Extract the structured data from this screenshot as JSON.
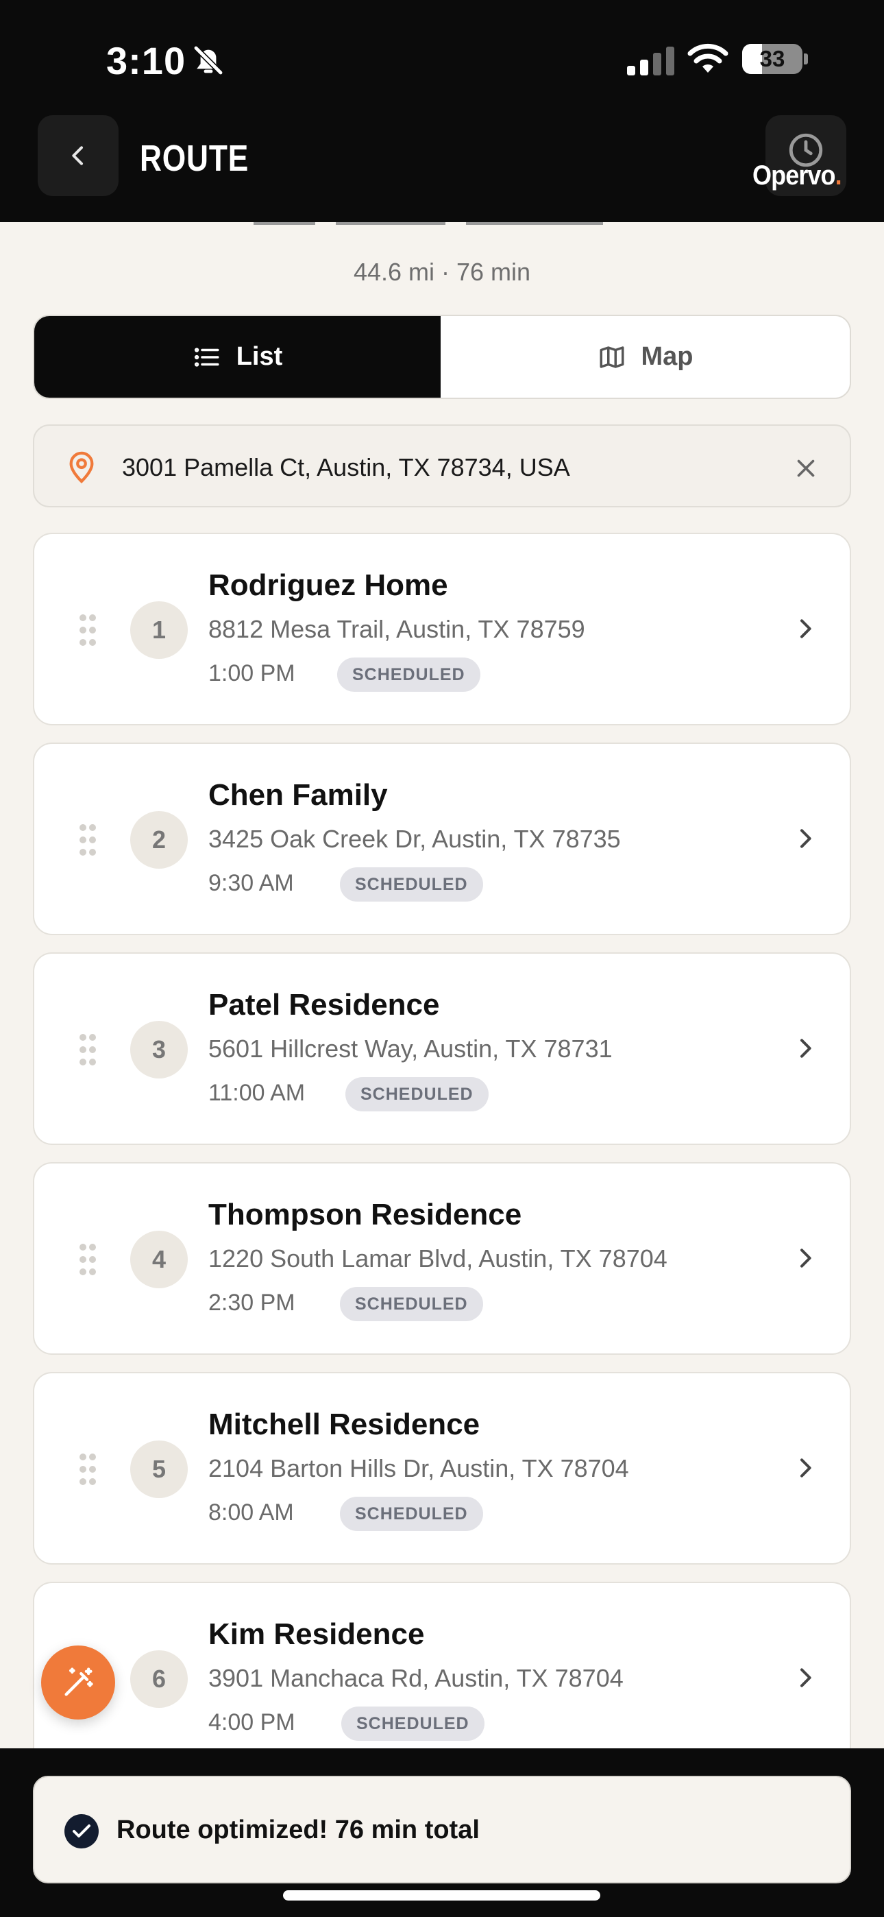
{
  "status_bar": {
    "time": "3:10",
    "battery": "33",
    "battery_level": 0.33
  },
  "header": {
    "title": "ROUTE",
    "brand": "Opervo",
    "brand_dot": "."
  },
  "summary": "44.6 mi · 76 min",
  "view_toggle": {
    "list_label": "List",
    "map_label": "Map",
    "selected": "List"
  },
  "start_location": {
    "value": "3001 Pamella Ct, Austin, TX 78734, USA"
  },
  "stops": [
    {
      "number": "1",
      "name": "Rodriguez Home",
      "address": "8812 Mesa Trail, Austin, TX 78759",
      "time": "1:00 PM",
      "status": "SCHEDULED"
    },
    {
      "number": "2",
      "name": "Chen Family",
      "address": "3425 Oak Creek Dr, Austin, TX 78735",
      "time": "9:30 AM",
      "status": "SCHEDULED"
    },
    {
      "number": "3",
      "name": "Patel Residence",
      "address": "5601 Hillcrest Way, Austin, TX 78731",
      "time": "11:00 AM",
      "status": "SCHEDULED"
    },
    {
      "number": "4",
      "name": "Thompson Residence",
      "address": "1220 South Lamar Blvd, Austin, TX 78704",
      "time": "2:30 PM",
      "status": "SCHEDULED"
    },
    {
      "number": "5",
      "name": "Mitchell Residence",
      "address": "2104 Barton Hills Dr, Austin, TX 78704",
      "time": "8:00 AM",
      "status": "SCHEDULED"
    },
    {
      "number": "6",
      "name": "Kim Residence",
      "address": "3901 Manchaca Rd, Austin, TX 78704",
      "time": "4:00 PM",
      "status": "SCHEDULED"
    }
  ],
  "toast": {
    "message": "Route optimized! 76 min total"
  },
  "colors": {
    "accent": "#f07a3a",
    "dark": "#0b0b0b",
    "background": "#f6f3ee",
    "badge_bg": "#e3e3e8"
  },
  "icons": {
    "back": "chevron-left-icon",
    "history": "clock-icon",
    "list": "list-icon",
    "map": "map-icon",
    "location": "map-pin-icon",
    "clear": "close-icon",
    "drag": "drag-handle-icon",
    "chevron": "chevron-right-icon",
    "optimize": "magic-wand-icon",
    "success": "check-circle-icon"
  }
}
